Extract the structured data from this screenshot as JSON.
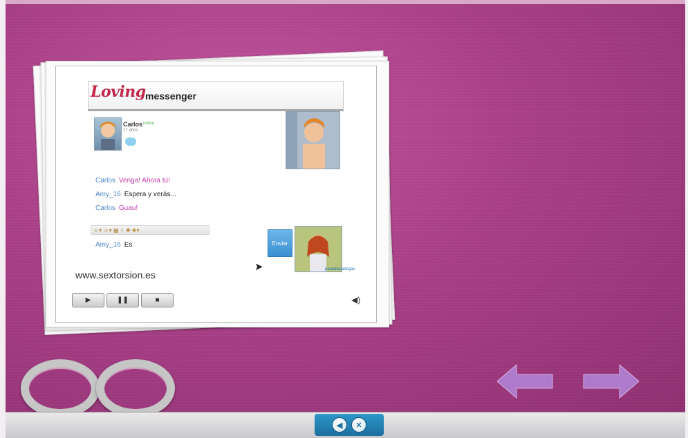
{
  "bottom_bar": {
    "audio_icon": "speaker-icon",
    "close_icon": "close-icon",
    "audio_glyph": "◀",
    "close_glyph": "✕"
  },
  "messenger": {
    "logo": "Loving",
    "title": "messenger",
    "contact": {
      "name": "Carlos",
      "status": "17 años",
      "online": "online"
    },
    "chat": [
      {
        "who": "Carlos",
        "text": "Venga! Ahora tú!",
        "tone": "pink"
      },
      {
        "who": "Amy_16",
        "text": "Espera y verás...",
        "tone": "dark"
      },
      {
        "who": "Carlos",
        "text": "Guau!",
        "tone": "pink"
      },
      {
        "who": "Amy_16",
        "text": "Es",
        "tone": "dark"
      }
    ],
    "emote_bar": "☺▾ ☺▾ ▦ ♆ ✚ ❀▾",
    "send_label": "Enviar",
    "brand_mini": "pantallasamigas"
  },
  "video_footer": {
    "url": "www.sextorsion.es",
    "play_glyph": "▶",
    "pause_glyph": "❚❚",
    "stop_glyph": "■",
    "volume_glyph": "◀)"
  },
  "colors": {
    "background": "#a83f86",
    "nav_arrow": "#b07acb",
    "pink_text": "#c53aa8",
    "name_text": "#4f86c6"
  }
}
